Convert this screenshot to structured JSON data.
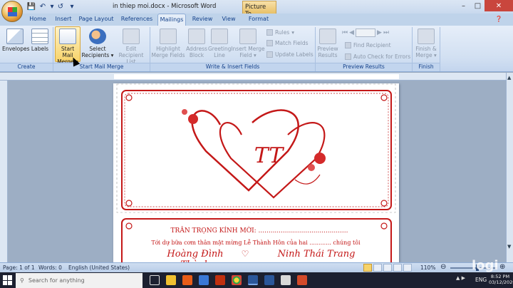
{
  "window": {
    "title": "in thiep moi.docx - Microsoft Word",
    "context_tab": "Picture To..."
  },
  "tabs": [
    "Home",
    "Insert",
    "Page Layout",
    "References",
    "Mailings",
    "Review",
    "View",
    "Format"
  ],
  "ribbon": {
    "create": {
      "envelopes": "Envelopes",
      "labels": "Labels",
      "label": "Create"
    },
    "start": {
      "start_l1": "Start Mail",
      "start_l2": "Merge",
      "select_l1": "Select",
      "select_l2": "Recipients",
      "edit_l1": "Edit",
      "edit_l2": "Recipient List",
      "label": "Start Mail Merge"
    },
    "write": {
      "highlight_l1": "Highlight",
      "highlight_l2": "Merge Fields",
      "address_l1": "Address",
      "address_l2": "Block",
      "greeting_l1": "Greeting",
      "greeting_l2": "Line",
      "insert_l1": "Insert Merge",
      "insert_l2": "Field",
      "rules": "Rules",
      "match": "Match Fields",
      "update": "Update Labels",
      "label": "Write & Insert Fields"
    },
    "preview": {
      "preview_l1": "Preview",
      "preview_l2": "Results",
      "find": "Find Recipient",
      "auto": "Auto Check for Errors",
      "label": "Preview Results"
    },
    "finish": {
      "finish_l1": "Finish &",
      "finish_l2": "Merge",
      "label": "Finish"
    }
  },
  "card": {
    "line1": "TRÂN TRỌNG KÍNH MỜI: ............................................",
    "line2": "Tới dự bữa cơm thân mật mừng Lễ Thành Hôn của hai ............ chúng tôi",
    "groom": "Hoàng Đình Thành",
    "bride": "Ninh Thái Trang",
    "monogram": "TT"
  },
  "status": {
    "page": "Page: 1 of 1",
    "words": "Words: 0",
    "language": "English (United States)",
    "zoom": "110%"
  },
  "taskbar": {
    "search_placeholder": "Search for anything",
    "lang": "ENG",
    "time": "8:52 PM",
    "date": "03/12/2020"
  },
  "watermark": "logi",
  "colors": {
    "card_red": "#c41818",
    "ribbon_blue": "#15428b",
    "highlight": "#f7d36a"
  }
}
